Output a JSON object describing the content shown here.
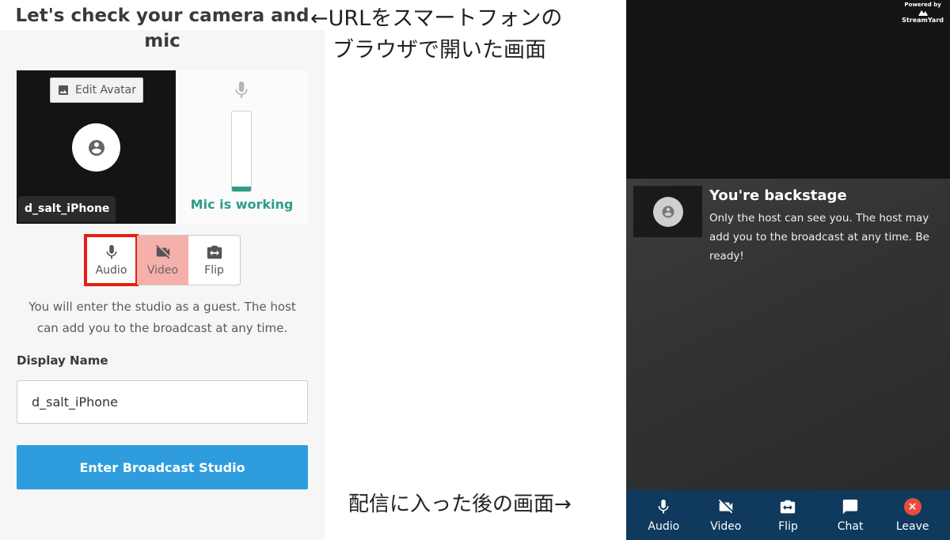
{
  "left": {
    "title": "Let's check your camera and mic",
    "edit_avatar_label": "Edit Avatar",
    "participant_name": "d_salt_iPhone",
    "mic_status": "Mic is working",
    "mic_level": 0.06,
    "controls": [
      {
        "label": "Audio",
        "icon": "mic-icon",
        "state": "on",
        "highlighted": true
      },
      {
        "label": "Video",
        "icon": "camera-off-icon",
        "state": "off",
        "highlighted": false
      },
      {
        "label": "Flip",
        "icon": "camera-flip-icon",
        "state": "on",
        "highlighted": false
      }
    ],
    "guest_note": "You will enter the studio as a guest. The host can add you to the broadcast at any time.",
    "display_name_label": "Display Name",
    "display_name_value": "d_salt_iPhone",
    "enter_button": "Enter Broadcast Studio"
  },
  "annotations": {
    "top_line1": "←URLをスマートフォンの",
    "top_line2": "ブラウザで開いた画面",
    "bottom": "配信に入った後の画面→"
  },
  "right": {
    "powered_by": "Powered by",
    "brand": "StreamYard",
    "backstage_title": "You're backstage",
    "backstage_text": "Only the host can see you. The host may add you to the broadcast at any time. Be ready!",
    "bar": [
      {
        "label": "Audio",
        "icon": "mic-icon"
      },
      {
        "label": "Video",
        "icon": "camera-off-icon"
      },
      {
        "label": "Flip",
        "icon": "camera-flip-icon"
      },
      {
        "label": "Chat",
        "icon": "chat-icon"
      },
      {
        "label": "Leave",
        "icon": "leave-icon"
      }
    ]
  },
  "colors": {
    "accent_blue": "#2f9ddd",
    "mic_green": "#2e9d86",
    "video_off": "#f5b0ab",
    "highlight_red": "#e32012",
    "bar_navy": "#0f3a5e",
    "leave_red": "#e74c3c"
  }
}
